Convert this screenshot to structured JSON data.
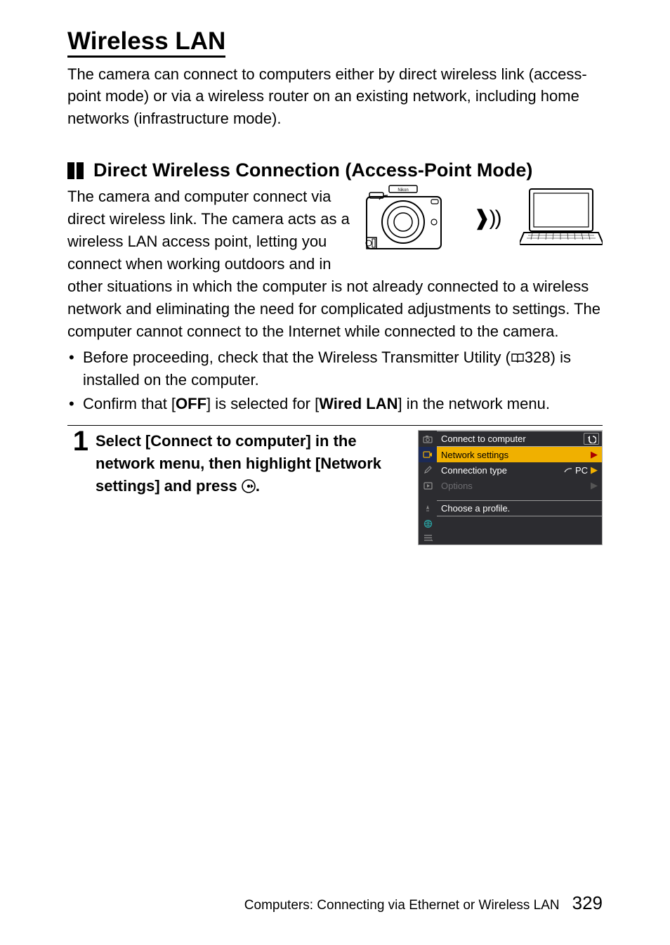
{
  "heading": "Wireless LAN",
  "intro": "The camera can connect to computers either by direct wireless link (access-point mode) or via a wireless router on an existing network, including home networks (infrastructure mode).",
  "subheading": "Direct Wireless Connection (Access-Point Mode)",
  "body": "The camera and computer connect via direct wireless link. The camera acts as a wireless LAN access point, letting you connect when working outdoors and in other situations in which the computer is not already connected to a wireless network and eliminating the need for complicated adjustments to settings. The computer cannot connect to the Internet while connected to the camera.",
  "bullet1_pre": "Before proceeding, check that the Wireless Transmitter Utility (",
  "bullet1_ref": "328",
  "bullet1_post": ") is installed on the computer.",
  "bullet2_a": "Confirm that [",
  "bullet2_b": "OFF",
  "bullet2_c": "] is selected for [",
  "bullet2_d": "Wired LAN",
  "bullet2_e": "] in the network menu.",
  "step1_num": "1",
  "step1_a": "Select [Connect to computer] in the network menu, then highlight [Network settings] and press ",
  "step1_b": ".",
  "menu": {
    "title": "Connect to computer",
    "row1": "Network settings",
    "row2": "Connection type",
    "row2_val": "PC",
    "row3": "Options",
    "helper": "Choose a profile."
  },
  "wifi_symbol": "❱))",
  "footer_text": "Computers: Connecting via Ethernet or Wireless LAN",
  "footer_page": "329"
}
